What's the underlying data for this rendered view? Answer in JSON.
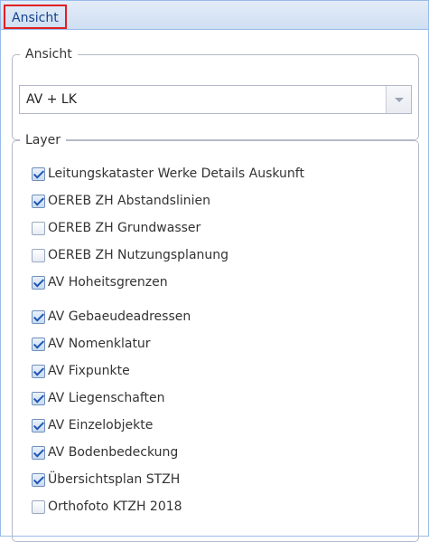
{
  "panel": {
    "title": "Ansicht"
  },
  "ansicht": {
    "legend": "Ansicht",
    "selected": "AV + LK"
  },
  "layer": {
    "legend": "Layer",
    "items": [
      {
        "label": "Leitungskataster Werke Details Auskunft",
        "checked": true
      },
      {
        "label": "OEREB ZH Abstandslinien",
        "checked": true
      },
      {
        "label": "OEREB ZH Grundwasser",
        "checked": false
      },
      {
        "label": "OEREB ZH Nutzungsplanung",
        "checked": false
      },
      {
        "label": "AV Hoheitsgrenzen",
        "checked": true
      },
      {
        "label": "AV Gebaeudeadressen",
        "checked": true
      },
      {
        "label": "AV Nomenklatur",
        "checked": true
      },
      {
        "label": "AV Fixpunkte",
        "checked": true
      },
      {
        "label": "AV Liegenschaften",
        "checked": true
      },
      {
        "label": "AV Einzelobjekte",
        "checked": true
      },
      {
        "label": "AV Bodenbedeckung",
        "checked": true
      },
      {
        "label": "Übersichtsplan STZH",
        "checked": true
      },
      {
        "label": "Orthofoto KTZH 2018",
        "checked": false
      }
    ]
  }
}
